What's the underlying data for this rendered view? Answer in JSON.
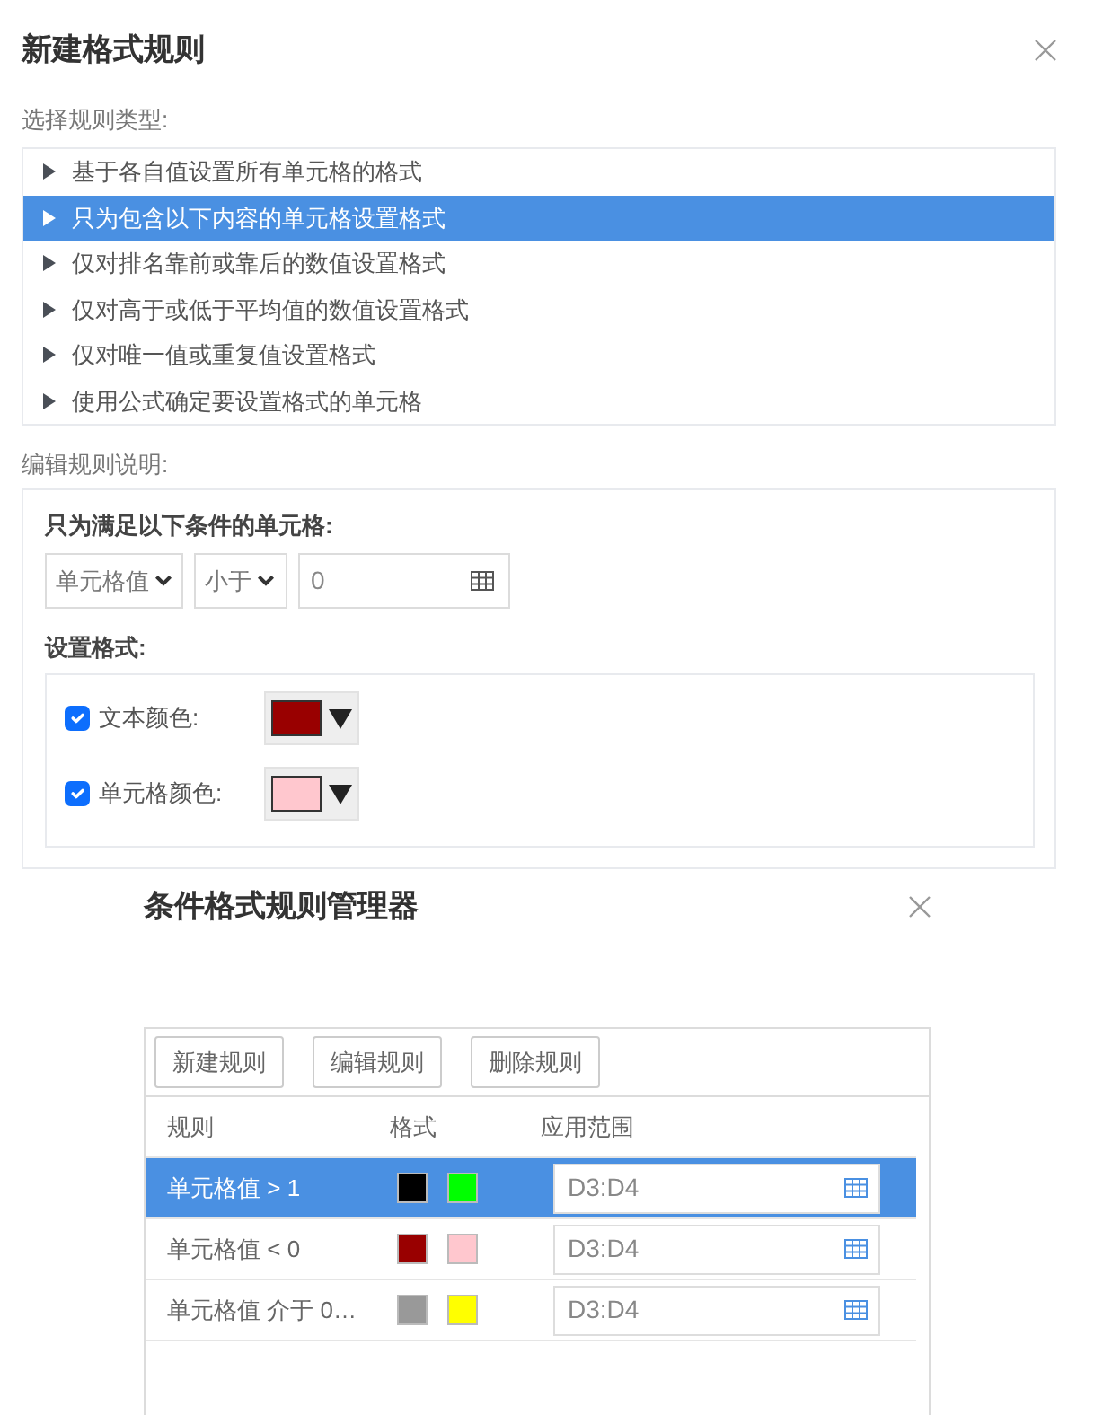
{
  "new_rule_dialog": {
    "title": "新建格式规则",
    "rule_type_label": "选择规则类型:",
    "rule_types": [
      {
        "label": "基于各自值设置所有单元格的格式",
        "selected": false
      },
      {
        "label": "只为包含以下内容的单元格设置格式",
        "selected": true
      },
      {
        "label": "仅对排名靠前或靠后的数值设置格式",
        "selected": false
      },
      {
        "label": "仅对高于或低于平均值的数值设置格式",
        "selected": false
      },
      {
        "label": "仅对唯一值或重复值设置格式",
        "selected": false
      },
      {
        "label": "使用公式确定要设置格式的单元格",
        "selected": false
      }
    ],
    "description_label": "编辑规则说明:",
    "condition_heading": "只为满足以下条件的单元格:",
    "condition": {
      "field": "单元格值",
      "operator": "小于",
      "value": "0"
    },
    "format_heading": "设置格式:",
    "format_options": [
      {
        "label": "文本颜色:",
        "checked": true,
        "color": "#990000"
      },
      {
        "label": "单元格颜色:",
        "checked": true,
        "color": "#ffc7ce"
      }
    ]
  },
  "manager_dialog": {
    "title": "条件格式规则管理器",
    "buttons": [
      "新建规则",
      "编辑规则",
      "删除规则"
    ],
    "columns": [
      "规则",
      "格式",
      "应用范围"
    ],
    "rules": [
      {
        "rule": "单元格值 > 1",
        "selected": true,
        "swatches": [
          {
            "color": "#000000"
          },
          {
            "color": "#00ff00"
          }
        ],
        "range": "D3:D4"
      },
      {
        "rule": "单元格值 < 0",
        "selected": false,
        "swatches": [
          {
            "color": "#990000"
          },
          {
            "color": "#ffc7ce"
          }
        ],
        "range": "D3:D4"
      },
      {
        "rule": "单元格值 介于 0…",
        "selected": false,
        "swatches": [
          {
            "color": "#999999"
          },
          {
            "color": "#ffff00"
          }
        ],
        "range": "D3:D4"
      }
    ]
  }
}
